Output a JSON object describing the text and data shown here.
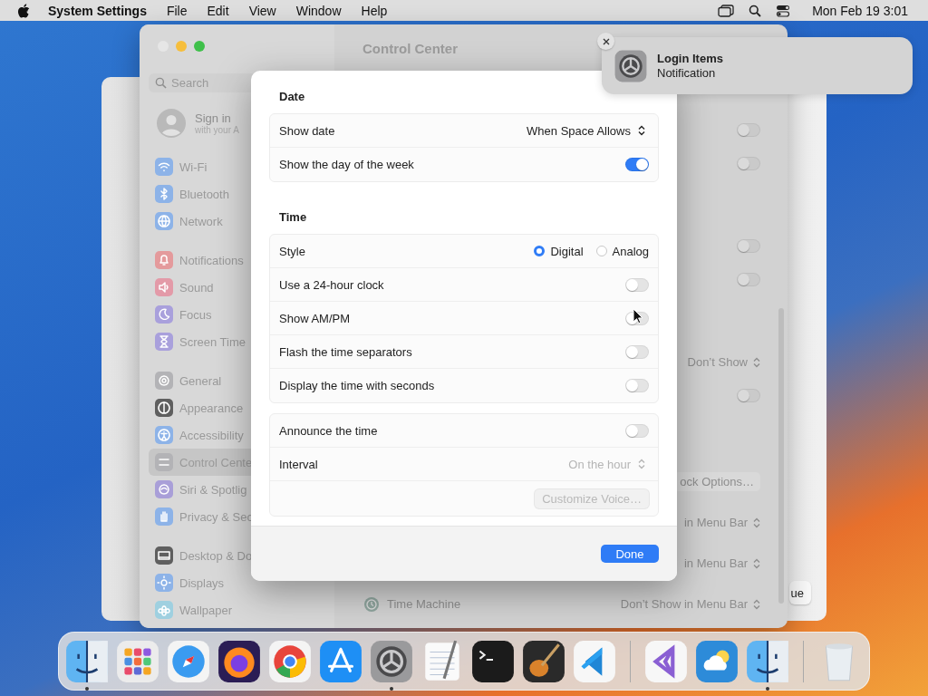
{
  "menu_bar": {
    "app_name": "System Settings",
    "menus": [
      "File",
      "Edit",
      "View",
      "Window",
      "Help"
    ],
    "clock": "Mon Feb 19  3:01"
  },
  "background_window": {
    "button_label": "ue"
  },
  "settings_window": {
    "title": "Control Center",
    "search_placeholder": "Search",
    "account": {
      "title": "Sign in",
      "subtitle": "with your A"
    },
    "sidebar_groups": [
      [
        {
          "label": "Wi-Fi",
          "kind": "wifi",
          "color": "#8db3e8",
          "selected": false
        },
        {
          "label": "Bluetooth",
          "kind": "bluetooth",
          "color": "#8db3e8",
          "selected": false
        },
        {
          "label": "Network",
          "kind": "globe",
          "color": "#8db3e8",
          "selected": false
        }
      ],
      [
        {
          "label": "Notifications",
          "kind": "bell",
          "color": "#e49a9c",
          "selected": false
        },
        {
          "label": "Sound",
          "kind": "speaker",
          "color": "#e39aa8",
          "selected": false
        },
        {
          "label": "Focus",
          "kind": "moon",
          "color": "#a9a0dc",
          "selected": false
        },
        {
          "label": "Screen Time",
          "kind": "hourglass",
          "color": "#a9a0dc",
          "selected": false
        }
      ],
      [
        {
          "label": "General",
          "kind": "gear",
          "color": "#b3b3b6",
          "selected": false
        },
        {
          "label": "Appearance",
          "kind": "contrast",
          "color": "#5f5f5f",
          "selected": false
        },
        {
          "label": "Accessibility",
          "kind": "person",
          "color": "#8db3e8",
          "selected": false
        },
        {
          "label": "Control Cente",
          "kind": "switches",
          "color": "#b3b3b6",
          "selected": true
        },
        {
          "label": "Siri & Spotlig",
          "kind": "orb",
          "color": "#a99fd8",
          "selected": false
        },
        {
          "label": "Privacy & Sec",
          "kind": "hand",
          "color": "#8db3e8",
          "selected": false
        }
      ],
      [
        {
          "label": "Desktop & Do",
          "kind": "dock",
          "color": "#5f5f5f",
          "selected": false
        },
        {
          "label": "Displays",
          "kind": "sun",
          "color": "#8db3e8",
          "selected": false
        },
        {
          "label": "Wallpaper",
          "kind": "flower",
          "color": "#9fd0e0",
          "selected": false
        }
      ]
    ],
    "content_sections": [
      [
        {
          "kind": "toggle",
          "on": false
        },
        {
          "kind": "toggle",
          "on": false
        }
      ],
      [
        {
          "kind": "toggle",
          "on": false
        },
        {
          "kind": "toggle",
          "on": false
        }
      ],
      [
        {
          "kind": "popup",
          "value": "Don’t Show"
        },
        {
          "kind": "toggle",
          "on": false
        }
      ],
      [
        {
          "kind": "button",
          "label": "ock Options…"
        },
        {
          "kind": "popup",
          "value": "in Menu Bar"
        },
        {
          "kind": "popup",
          "value": "in Menu Bar"
        },
        {
          "kind": "labeled_popup",
          "label": "Time Machine",
          "value": "Don’t Show in Menu Bar"
        }
      ]
    ]
  },
  "clock_options_sheet": {
    "sections": [
      {
        "title": "Date",
        "rows": [
          {
            "kind": "popup",
            "label": "Show date",
            "value": "When Space Allows",
            "disabled": false
          },
          {
            "kind": "toggle",
            "label": "Show the day of the week",
            "on": true
          }
        ]
      },
      {
        "title": "Time",
        "rows": [
          {
            "kind": "radio",
            "label": "Style",
            "options": [
              {
                "label": "Digital",
                "selected": true
              },
              {
                "label": "Analog",
                "selected": false
              }
            ]
          },
          {
            "kind": "toggle",
            "label": "Use a 24-hour clock",
            "on": false
          },
          {
            "kind": "toggle",
            "label": "Show AM/PM",
            "on": false
          },
          {
            "kind": "toggle",
            "label": "Flash the time separators",
            "on": false
          },
          {
            "kind": "toggle",
            "label": "Display the time with seconds",
            "on": false
          }
        ]
      },
      {
        "rows": [
          {
            "kind": "toggle",
            "label": "Announce the time",
            "on": false
          },
          {
            "kind": "popup",
            "label": "Interval",
            "value": "On the hour",
            "disabled": true
          },
          {
            "kind": "button",
            "label": "Customize Voice…",
            "disabled": true
          }
        ]
      }
    ],
    "done_label": "Done"
  },
  "notification": {
    "title": "Login Items",
    "body": "Notification"
  },
  "dock": {
    "groups": [
      [
        {
          "kind": "finder",
          "running": true
        },
        {
          "kind": "launchpad",
          "running": false
        },
        {
          "kind": "safari",
          "running": false
        },
        {
          "kind": "firefox",
          "running": false
        },
        {
          "kind": "chrome",
          "running": false
        },
        {
          "kind": "appstore",
          "running": false
        },
        {
          "kind": "settings",
          "running": true
        },
        {
          "kind": "textedit",
          "running": false
        },
        {
          "kind": "terminal",
          "running": false
        },
        {
          "kind": "garageband",
          "running": false
        },
        {
          "kind": "vscode",
          "running": false
        }
      ],
      [
        {
          "kind": "visualstudio",
          "running": false
        },
        {
          "kind": "weather",
          "running": false
        },
        {
          "kind": "migration",
          "running": true
        }
      ],
      [
        {
          "kind": "trash",
          "running": false
        }
      ]
    ]
  }
}
